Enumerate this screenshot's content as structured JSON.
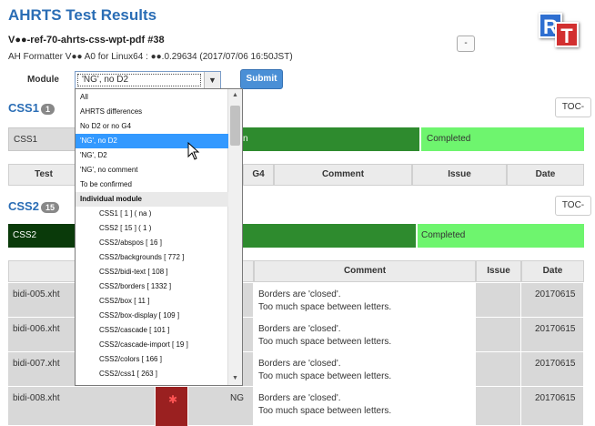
{
  "header": {
    "title": "AHRTS Test Results",
    "subtitle": "V●●-ref-70-ahrts-css-wpt-pdf #38",
    "formatter": "AH Formatter V●● A0 for Linux64 : ●●.0.29634 (2017/07/06 16:50JST)",
    "mini_button": "-",
    "logo_r": "R",
    "logo_t": "T"
  },
  "form": {
    "module_label": "Module",
    "select_value": "'NG', no D2",
    "submit_label": "Submit"
  },
  "dropdown": {
    "items": [
      {
        "label": "All",
        "kind": "plain"
      },
      {
        "label": "AHRTS differences",
        "kind": "plain"
      },
      {
        "label": "No D2 or no G4",
        "kind": "plain"
      },
      {
        "label": "'NG', no D2",
        "kind": "selected"
      },
      {
        "label": "'NG', D2",
        "kind": "plain"
      },
      {
        "label": "'NG', no comment",
        "kind": "plain"
      },
      {
        "label": "To be confirmed",
        "kind": "plain"
      },
      {
        "label": "Individual module",
        "kind": "group"
      },
      {
        "label": "CSS1   [ 1 ]   ( na )",
        "kind": "opt"
      },
      {
        "label": "CSS2   [ 15 ]   ( 1 )",
        "kind": "opt"
      },
      {
        "label": "CSS2/abspos   [ 16 ]",
        "kind": "opt"
      },
      {
        "label": "CSS2/backgrounds   [ 772 ]",
        "kind": "opt"
      },
      {
        "label": "CSS2/bidi-text   [ 108 ]",
        "kind": "opt"
      },
      {
        "label": "CSS2/borders   [ 1332 ]",
        "kind": "opt"
      },
      {
        "label": "CSS2/box   [ 11 ]",
        "kind": "opt"
      },
      {
        "label": "CSS2/box-display   [ 109 ]",
        "kind": "opt"
      },
      {
        "label": "CSS2/cascade   [ 101 ]",
        "kind": "opt"
      },
      {
        "label": "CSS2/cascade-import   [ 19 ]",
        "kind": "opt"
      },
      {
        "label": "CSS2/colors   [ 166 ]",
        "kind": "opt"
      },
      {
        "label": "CSS2/css1   [ 263 ]",
        "kind": "opt"
      }
    ]
  },
  "css1": {
    "heading": "CSS1",
    "badge": "1",
    "toc": "TOC-",
    "row_label": "CSS1",
    "green_tail": "n",
    "status": "Completed",
    "columns": [
      "Test",
      "G4",
      "Comment",
      "Issue",
      "Date"
    ]
  },
  "css2": {
    "heading": "CSS2",
    "badge": "15",
    "toc": "TOC-",
    "row_label": "CSS2",
    "status": "Completed",
    "columns": [
      "Comment",
      "Issue",
      "Date"
    ],
    "rows": [
      {
        "test": "bidi-005.xht",
        "result": "",
        "comment1": "Borders are 'closed'.",
        "comment2": "Too much space between letters.",
        "date": "20170615"
      },
      {
        "test": "bidi-006.xht",
        "result": "",
        "comment1": "Borders are 'closed'.",
        "comment2": "Too much space between letters.",
        "date": "20170615"
      },
      {
        "test": "bidi-007.xht",
        "result": "",
        "comment1": "Borders are 'closed'.",
        "comment2": "Too much space between letters.",
        "date": "20170615"
      },
      {
        "test": "bidi-008.xht",
        "result": "NG",
        "comment1": "Borders are 'closed'.",
        "comment2": "Too much space between letters.",
        "date": "20170615"
      }
    ]
  },
  "colors": {
    "accent": "#2a6db5",
    "completed": "#6ef56e",
    "progress": "#2e8b2e",
    "fail": "#9a2020"
  }
}
